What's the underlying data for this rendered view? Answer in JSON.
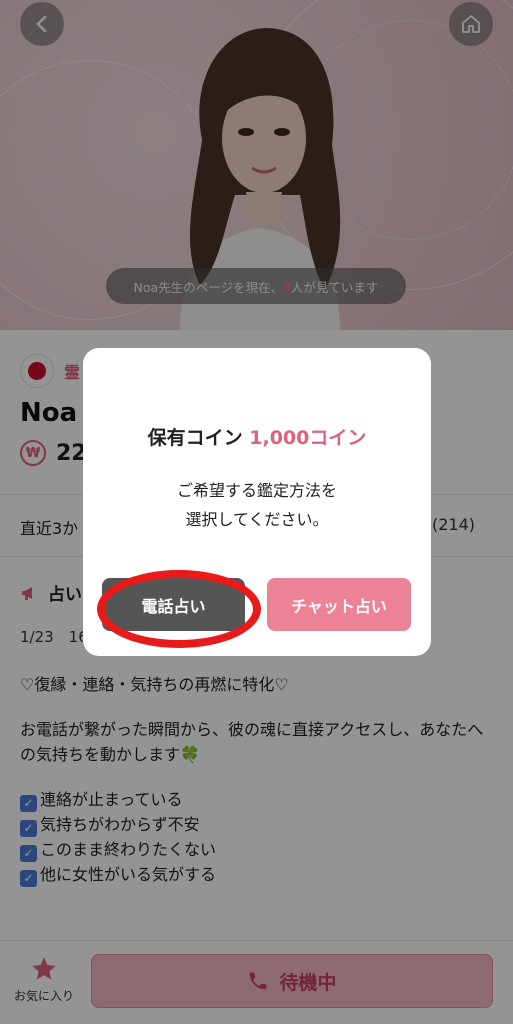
{
  "hero": {
    "viewers_prefix": "Noa先生のページを現在、",
    "viewers_count": "4",
    "viewers_suffix": "人が見ています"
  },
  "profile": {
    "category": "霊",
    "name": "Noa (",
    "price": "22"
  },
  "stats": {
    "left": "直近3か",
    "right": "(214)"
  },
  "notice": {
    "title": "占い",
    "date": "1/23　16"
  },
  "description": {
    "line1": "♡復縁・連絡・気持ちの再燃に特化♡",
    "para": "お電話が繋がった瞬間から、彼の魂に直接アクセスし、あなたへの気持ちを動かします",
    "clover": "🍀",
    "checks": [
      "連絡が止まっている",
      "気持ちがわからず不安",
      "このまま終わりたくない",
      "他に女性がいる気がする"
    ]
  },
  "bottom": {
    "favorite_label": "お気に入り",
    "standby_label": "待機中"
  },
  "modal": {
    "coins_label": "保有コイン",
    "coins_amount": "1,000コイン",
    "message_line1": "ご希望する鑑定方法を",
    "message_line2": "選択してください。",
    "phone_button": "電話占い",
    "chat_button": "チャット占い"
  },
  "colors": {
    "accent_pink": "#e0607d",
    "phone_button": "#555555",
    "chat_button": "#ec8295",
    "annotation_red": "#e81a1a"
  },
  "icons": [
    "back-arrow-icon",
    "home-icon",
    "flag-icon",
    "coin-icon",
    "megaphone-icon",
    "star-icon",
    "phone-icon",
    "check-icon",
    "clover-icon"
  ]
}
